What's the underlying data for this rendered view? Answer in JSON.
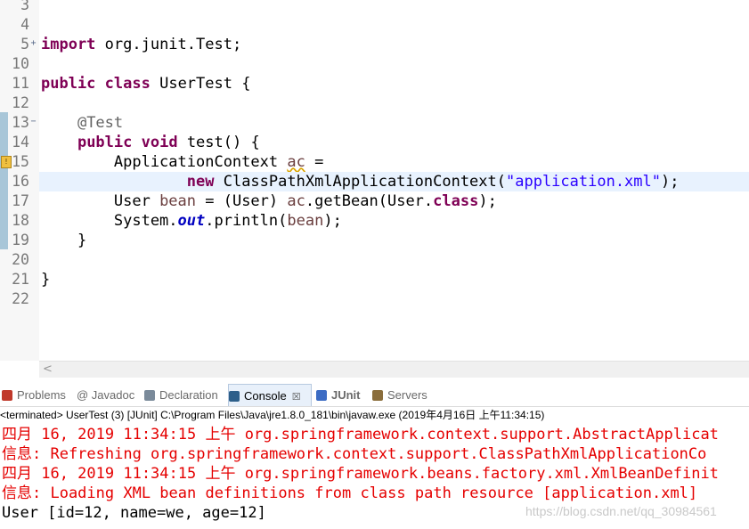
{
  "editor": {
    "lines": [
      {
        "num": "3"
      },
      {
        "num": "4"
      },
      {
        "num": "5",
        "fold": "+",
        "code": [
          {
            "t": "import",
            "c": "kw"
          },
          {
            "t": " org.junit.Test;"
          }
        ]
      },
      {
        "num": "10"
      },
      {
        "num": "11",
        "code": [
          {
            "t": "public",
            "c": "kw"
          },
          {
            "t": " "
          },
          {
            "t": "class",
            "c": "kw"
          },
          {
            "t": " UserTest {"
          }
        ]
      },
      {
        "num": "12"
      },
      {
        "num": "13",
        "fold": "−",
        "code": [
          {
            "t": "    "
          },
          {
            "t": "@Test",
            "c": "ann"
          }
        ]
      },
      {
        "num": "14",
        "code": [
          {
            "t": "    "
          },
          {
            "t": "public",
            "c": "kw"
          },
          {
            "t": " "
          },
          {
            "t": "void",
            "c": "kw"
          },
          {
            "t": " test() {"
          }
        ]
      },
      {
        "num": "15",
        "warning": true,
        "code": [
          {
            "t": "        ApplicationContext "
          },
          {
            "t": "ac",
            "c": "var warn-var"
          },
          {
            "t": " ="
          }
        ]
      },
      {
        "num": "16",
        "highlight": true,
        "code": [
          {
            "t": "                "
          },
          {
            "t": "new",
            "c": "kw"
          },
          {
            "t": " ClassPathXmlApplicationContext("
          },
          {
            "t": "\"application.xml\"",
            "c": "str"
          },
          {
            "t": ");"
          }
        ]
      },
      {
        "num": "17",
        "code": [
          {
            "t": "        User "
          },
          {
            "t": "bean",
            "c": "var"
          },
          {
            "t": " = (User) "
          },
          {
            "t": "ac",
            "c": "var"
          },
          {
            "t": ".getBean(User."
          },
          {
            "t": "class",
            "c": "kw"
          },
          {
            "t": ");"
          }
        ]
      },
      {
        "num": "18",
        "code": [
          {
            "t": "        System."
          },
          {
            "t": "out",
            "c": "fld"
          },
          {
            "t": ".println("
          },
          {
            "t": "bean",
            "c": "var"
          },
          {
            "t": ");"
          }
        ]
      },
      {
        "num": "19",
        "code": [
          {
            "t": "    }"
          }
        ]
      },
      {
        "num": "20"
      },
      {
        "num": "21",
        "code": [
          {
            "t": "}"
          }
        ]
      },
      {
        "num": "22"
      }
    ]
  },
  "scroll": {
    "left_arrow": "<"
  },
  "tabs": [
    {
      "label": "Problems",
      "icon": "problems-icon",
      "color": "#c0392b"
    },
    {
      "label": "@ Javadoc",
      "icon": "javadoc-icon",
      "color": ""
    },
    {
      "label": "Declaration",
      "icon": "declaration-icon",
      "color": "#7a8a9a"
    },
    {
      "label": "Console",
      "icon": "console-icon",
      "color": "#2d5f8a",
      "active": true,
      "close": "☒"
    },
    {
      "label": "JUnit",
      "icon": "junit-icon",
      "color": "#3c6cc4"
    },
    {
      "label": "Servers",
      "icon": "servers-icon",
      "color": "#8a6d3b"
    }
  ],
  "status": "<terminated> UserTest (3) [JUnit] C:\\Program Files\\Java\\jre1.8.0_181\\bin\\javaw.exe (2019年4月16日 上午11:34:15)",
  "console": [
    {
      "text": "四月 16, 2019 11:34:15 上午 org.springframework.context.support.AbstractApplicat",
      "color": "red"
    },
    {
      "text": "信息: Refreshing org.springframework.context.support.ClassPathXmlApplicationCo",
      "color": "red"
    },
    {
      "text": "四月 16, 2019 11:34:15 上午 org.springframework.beans.factory.xml.XmlBeanDefinit",
      "color": "red"
    },
    {
      "text": "信息: Loading XML bean definitions from class path resource [application.xml]",
      "color": "red"
    },
    {
      "text": "User [id=12, name=we, age=12]",
      "color": "blk"
    }
  ],
  "watermark": "https://blog.csdn.net/qq_30984561"
}
